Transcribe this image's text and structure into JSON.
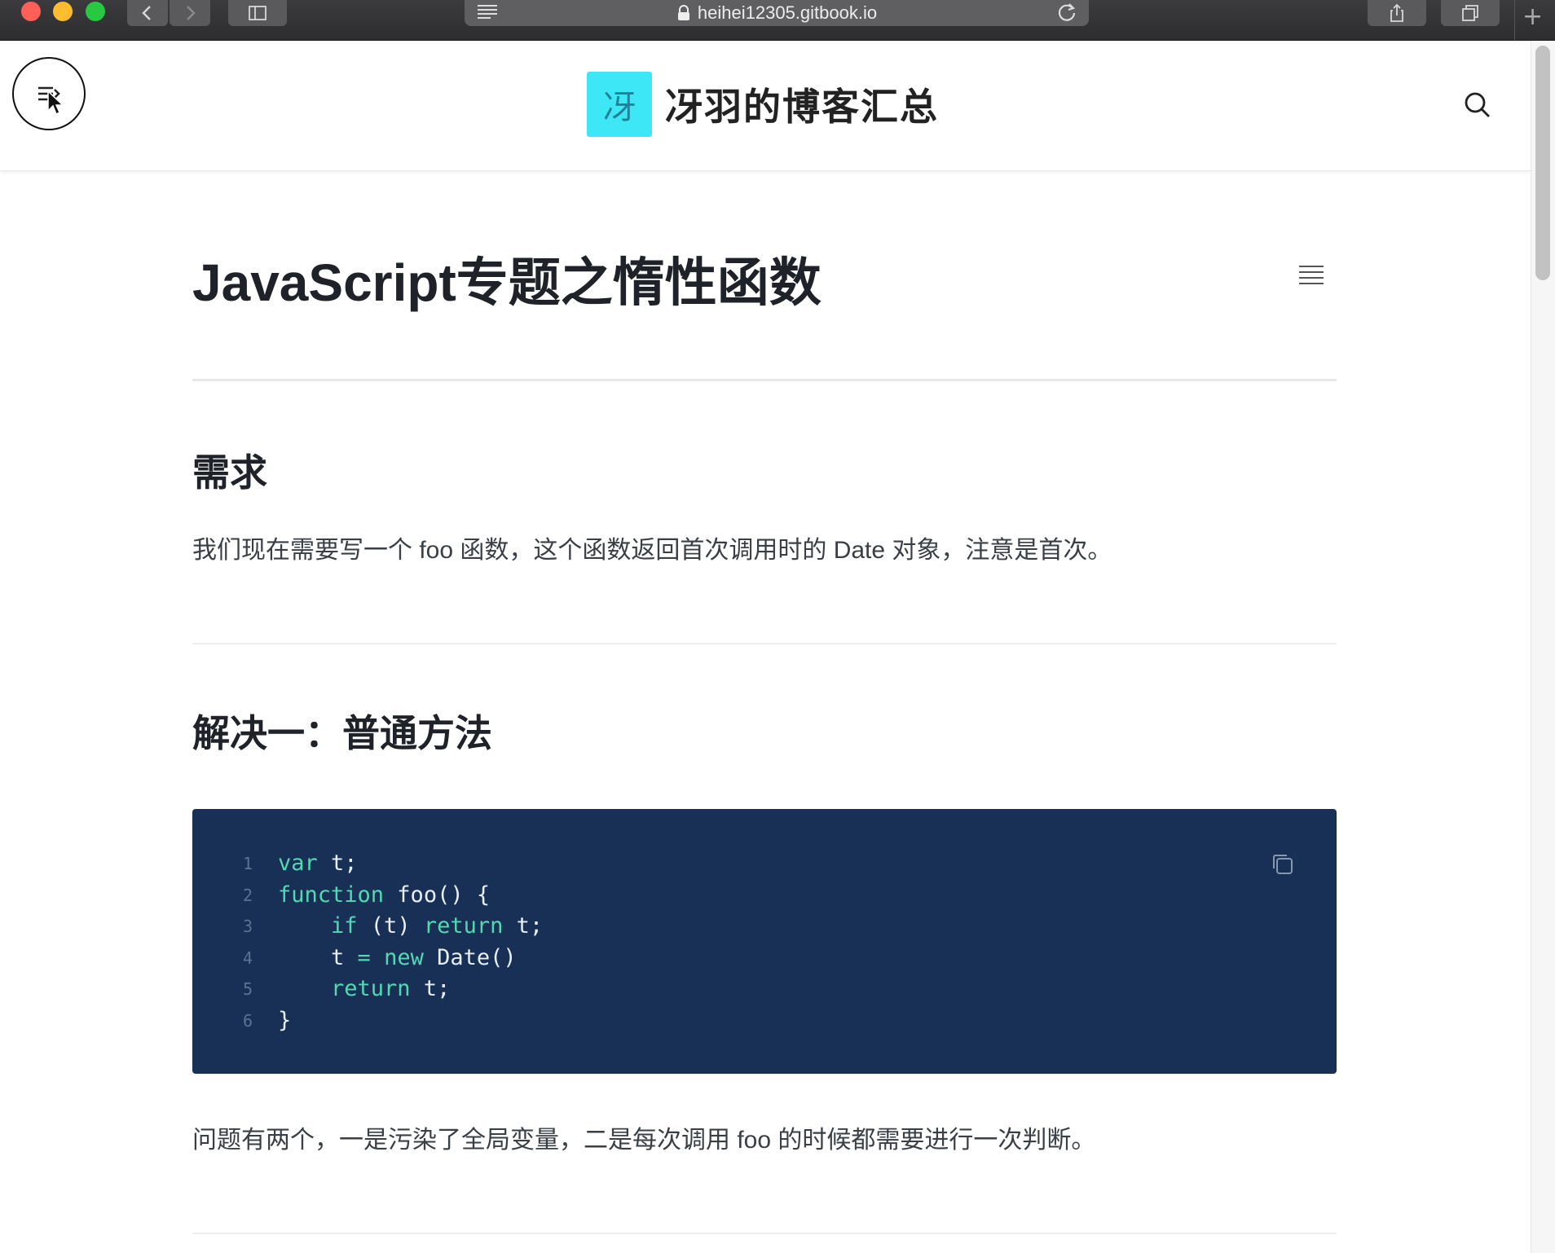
{
  "browser": {
    "url": "heihei12305.gitbook.io",
    "buttons": {
      "back": "back-icon",
      "forward": "forward-icon",
      "sidebar": "sidebar-icon",
      "share": "share-icon",
      "tabs": "tabs-icon",
      "new_tab": "+"
    }
  },
  "header": {
    "logo_char": "冴",
    "site_title": "冴羽的博客汇总",
    "logo_color": "#3ee7f6"
  },
  "article": {
    "title": "JavaScript专题之惰性函数",
    "sections": [
      {
        "heading": "需求",
        "text": "我们现在需要写一个 foo 函数，这个函数返回首次调用时的 Date 对象，注意是首次。"
      },
      {
        "heading": "解决一：普通方法"
      }
    ],
    "code": {
      "lines": [
        {
          "n": "1",
          "tokens": [
            {
              "t": "var",
              "k": "kw"
            },
            {
              "t": " t;",
              "k": ""
            }
          ]
        },
        {
          "n": "2",
          "tokens": [
            {
              "t": "function",
              "k": "kw"
            },
            {
              "t": " foo() {",
              "k": ""
            }
          ]
        },
        {
          "n": "3",
          "tokens": [
            {
              "t": "    ",
              "k": ""
            },
            {
              "t": "if",
              "k": "kw"
            },
            {
              "t": " (t) ",
              "k": ""
            },
            {
              "t": "return",
              "k": "kw"
            },
            {
              "t": " t;",
              "k": ""
            }
          ]
        },
        {
          "n": "4",
          "tokens": [
            {
              "t": "    t ",
              "k": ""
            },
            {
              "t": "=",
              "k": "op"
            },
            {
              "t": " ",
              "k": ""
            },
            {
              "t": "new",
              "k": "kw"
            },
            {
              "t": " Date()",
              "k": ""
            }
          ]
        },
        {
          "n": "5",
          "tokens": [
            {
              "t": "    ",
              "k": ""
            },
            {
              "t": "return",
              "k": "kw"
            },
            {
              "t": " t;",
              "k": ""
            }
          ]
        },
        {
          "n": "6",
          "tokens": [
            {
              "t": "}",
              "k": ""
            }
          ]
        }
      ],
      "background": "#183055",
      "keyword_color": "#52d9b3"
    },
    "after_code_text": "问题有两个，一是污染了全局变量，二是每次调用 foo 的时候都需要进行一次判断。"
  }
}
